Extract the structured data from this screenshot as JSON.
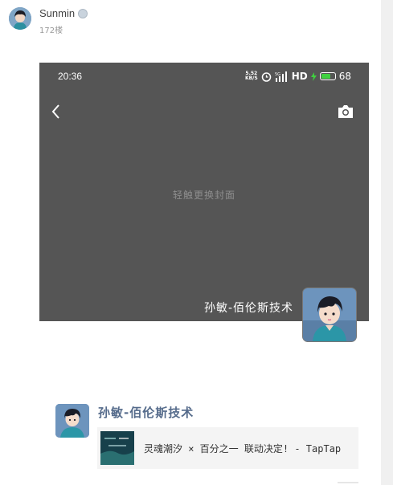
{
  "post": {
    "author": "Sunmin",
    "floor": "172楼"
  },
  "phone": {
    "status_time": "20:36",
    "net_speed_value": "5.52",
    "net_speed_unit": "KB/S",
    "signal_label": "5G",
    "hd_label": "HD",
    "battery_percent": "68",
    "battery_level": 0.68,
    "battery_color": "#3fd13f",
    "cover_hint": "轻触更换封面",
    "profile_name": "孙敏-佰伦斯技术"
  },
  "share": {
    "user_name": "孙敏-佰伦斯技术",
    "link_title": "灵魂潮汐 × 百分之一 联动决定! - TapTap"
  },
  "colors": {
    "phone_background": "#555555",
    "share_name": "#556b8b"
  }
}
